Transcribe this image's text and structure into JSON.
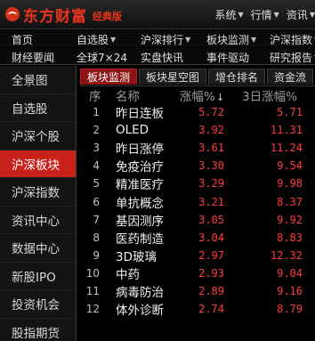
{
  "app": {
    "name": "东方财富",
    "edition": "经典版"
  },
  "top_menu": [
    {
      "label": "系统",
      "has_dropdown": true
    },
    {
      "label": "行情",
      "has_dropdown": true
    },
    {
      "label": "资讯",
      "has_dropdown": true
    }
  ],
  "nav_row1": [
    {
      "label": "首页",
      "has_dropdown": false
    },
    {
      "label": "自选股",
      "has_dropdown": true
    },
    {
      "label": "沪深排行",
      "has_dropdown": true
    },
    {
      "label": "板块监测",
      "has_dropdown": true
    },
    {
      "label": "沪深指数",
      "has_dropdown": true
    }
  ],
  "nav_row2": [
    {
      "label": "财经要闻",
      "has_dropdown": false
    },
    {
      "label": "全球7×24",
      "has_dropdown": false
    },
    {
      "label": "实盘快讯",
      "has_dropdown": false
    },
    {
      "label": "事件驱动",
      "has_dropdown": false
    },
    {
      "label": "研究报告",
      "has_dropdown": true
    }
  ],
  "sidebar": [
    {
      "label": "全景图",
      "active": false
    },
    {
      "label": "自选股",
      "active": false
    },
    {
      "label": "沪深个股",
      "active": false
    },
    {
      "label": "沪深板块",
      "active": true
    },
    {
      "label": "沪深指数",
      "active": false
    },
    {
      "label": "资讯中心",
      "active": false
    },
    {
      "label": "数据中心",
      "active": false
    },
    {
      "label": "新股IPO",
      "active": false
    },
    {
      "label": "投资机会",
      "active": false
    },
    {
      "label": "股指期货",
      "active": false
    }
  ],
  "tabs": [
    {
      "label": "板块监测",
      "active": true
    },
    {
      "label": "板块星空图",
      "active": false
    },
    {
      "label": "增仓排名",
      "active": false
    },
    {
      "label": "资金流",
      "active": false
    }
  ],
  "table": {
    "headers": {
      "no": "序",
      "name": "名称",
      "change": "涨幅%",
      "sort_indicator": "↓",
      "change3d": "3日涨幅%"
    },
    "rows": [
      {
        "no": "1",
        "name": "昨日连板",
        "change": "5.72",
        "change3d": "5.71"
      },
      {
        "no": "2",
        "name": "OLED",
        "change": "3.92",
        "change3d": "11.31"
      },
      {
        "no": "3",
        "name": "昨日涨停",
        "change": "3.61",
        "change3d": "11.24"
      },
      {
        "no": "4",
        "name": "免疫治疗",
        "change": "3.30",
        "change3d": "9.54"
      },
      {
        "no": "5",
        "name": "精准医疗",
        "change": "3.29",
        "change3d": "9.98"
      },
      {
        "no": "6",
        "name": "单抗概念",
        "change": "3.21",
        "change3d": "8.37"
      },
      {
        "no": "7",
        "name": "基因测序",
        "change": "3.05",
        "change3d": "9.92"
      },
      {
        "no": "8",
        "name": "医药制造",
        "change": "3.04",
        "change3d": "8.83"
      },
      {
        "no": "9",
        "name": "3D玻璃",
        "change": "2.97",
        "change3d": "12.32"
      },
      {
        "no": "10",
        "name": "中药",
        "change": "2.93",
        "change3d": "9.04"
      },
      {
        "no": "11",
        "name": "病毒防治",
        "change": "2.89",
        "change3d": "9.16"
      },
      {
        "no": "12",
        "name": "体外诊断",
        "change": "2.74",
        "change3d": "8.79"
      }
    ]
  },
  "colors": {
    "accent_red": "#c9221a",
    "up_red": "#ff3d3d",
    "logo_red": "#e8341c"
  }
}
